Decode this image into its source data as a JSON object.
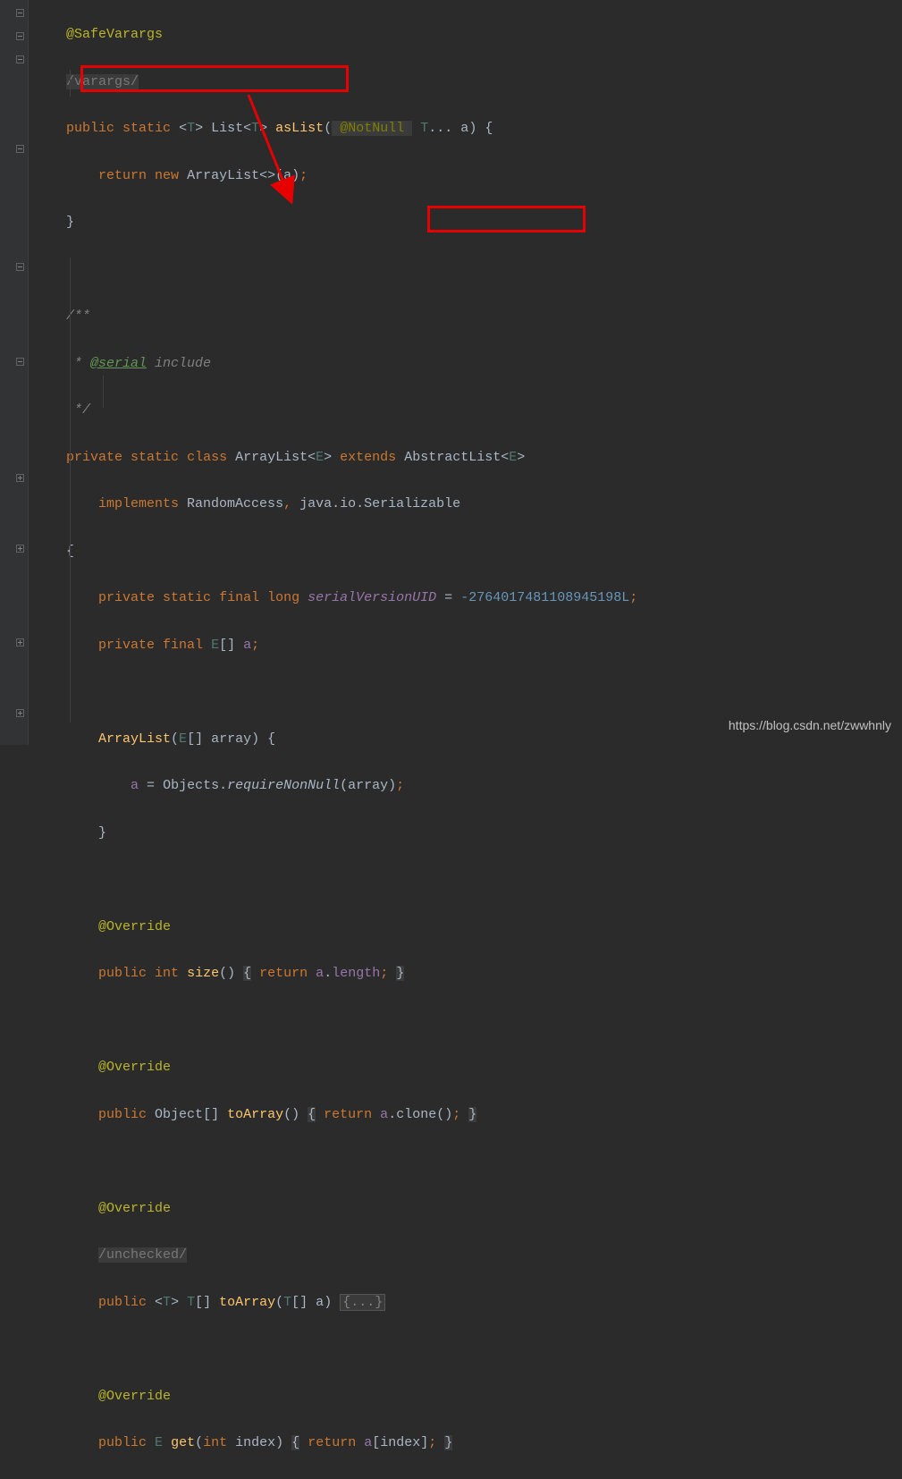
{
  "code": {
    "l1": "@SafeVarargs",
    "l2": "/varargs/",
    "l3_public": "public",
    "l3_static": "static",
    "l3_list": "List",
    "l3_T": "T",
    "l3_asList": "asList",
    "l3_notnull": "@NotNull",
    "l3_a": "a",
    "l4_return": "return",
    "l4_new": "new",
    "l4_ArrayList": "ArrayList",
    "l4_a": "a",
    "l7_doc1": "/**",
    "l8_doc2": " * ",
    "l8_serial": "@serial",
    "l8_include": " include",
    "l9_doc3": " */",
    "l10_private": "private",
    "l10_static": "static",
    "l10_class": "class",
    "l10_ArrayList": "ArrayList",
    "l10_E": "E",
    "l10_extends": "extends",
    "l10_AbstractList": "AbstractList",
    "l11_implements": "implements",
    "l11_RandomAccess": "RandomAccess",
    "l11_javaio": "java.io.Serializable",
    "l13_private": "private",
    "l13_static": "static",
    "l13_final": "final",
    "l13_long": "long",
    "l13_svuid": "serialVersionUID",
    "l13_val": "-2764017481108945198L",
    "l14_private": "private",
    "l14_final": "final",
    "l14_E": "E",
    "l14_a": "a",
    "l16_ArrayList": "ArrayList",
    "l16_E": "E",
    "l16_array": "array",
    "l17_a": "a",
    "l17_Objects": "Objects",
    "l17_rnn": "requireNonNull",
    "l17_array": "array",
    "l20_Override": "@Override",
    "l21_public": "public",
    "l21_int": "int",
    "l21_size": "size",
    "l21_return": "return",
    "l21_a": "a",
    "l21_length": "length",
    "l23_Override": "@Override",
    "l24_public": "public",
    "l24_Object": "Object",
    "l24_toArray": "toArray",
    "l24_return": "return",
    "l24_a": "a",
    "l24_clone": "clone",
    "l26_Override": "@Override",
    "l27_unchecked": "/unchecked/",
    "l28_public": "public",
    "l28_T": "T",
    "l28_toArray": "toArray",
    "l28_a": "a",
    "l28_fold": "{...}",
    "l30_Override": "@Override",
    "l31_public": "public",
    "l31_E": "E",
    "l31_get": "get",
    "l31_int": "int",
    "l31_index": "index",
    "l31_return": "return",
    "l31_a": "a",
    "l31_index2": "index"
  },
  "watermark": "https://blog.csdn.net/zwwhnly"
}
